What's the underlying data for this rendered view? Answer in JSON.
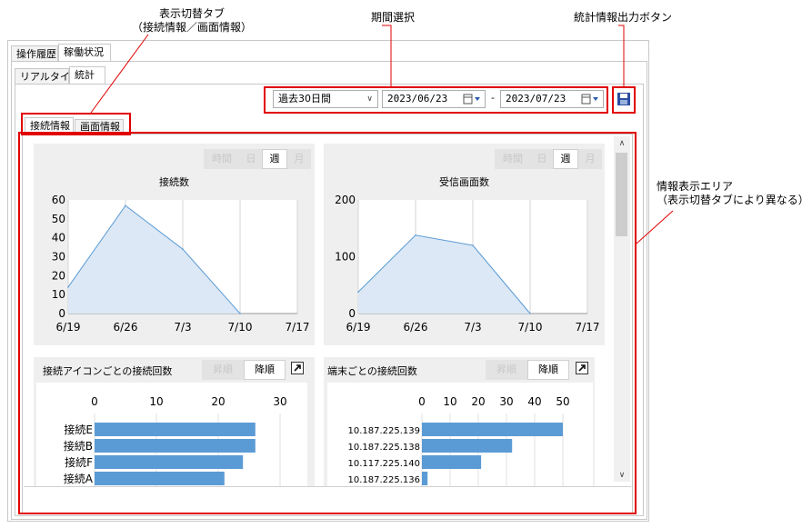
{
  "callouts": {
    "tab_switch_line1": "表示切替タブ",
    "tab_switch_line2": "（接続情報／画面情報）",
    "period_select": "期間選択",
    "stats_output": "統計情報出力ボタン",
    "info_area_line1": "情報表示エリア",
    "info_area_line2": "（表示切替タブにより異なる）"
  },
  "tabs_top": [
    "操作履歴",
    "稼働状況"
  ],
  "tabs_second": [
    "リアルタイム",
    "統計"
  ],
  "tabs_info": [
    "接続情報",
    "画面情報"
  ],
  "period": {
    "selected": "過去30日間",
    "from": "2023/06/23",
    "dash": "-",
    "to": "2023/07/23"
  },
  "segments_time": [
    "時間",
    "日",
    "週",
    "月"
  ],
  "segments_sort": [
    "昇順",
    "降順"
  ],
  "colors": {
    "accent": "#5b9bd5",
    "area": "#dce8f5",
    "highlight": "#e00000"
  },
  "icons": {
    "save": "floppy-disk-icon",
    "calendar": "calendar-icon",
    "popout": "popout-arrow-icon"
  },
  "chart_data": [
    {
      "type": "area",
      "title": "接続数",
      "categories": [
        "6/19",
        "6/26",
        "7/3",
        "7/10",
        "7/17"
      ],
      "x": [
        "6/19",
        "6/26",
        "7/3",
        "7/10"
      ],
      "values": [
        14,
        57,
        34,
        0
      ],
      "ylim": [
        0,
        60
      ],
      "yticks": [
        0,
        10,
        20,
        30,
        40,
        50,
        60
      ],
      "grid": true
    },
    {
      "type": "area",
      "title": "受信画面数",
      "categories": [
        "6/19",
        "6/26",
        "7/3",
        "7/10",
        "7/17"
      ],
      "x": [
        "6/19",
        "6/26",
        "7/3",
        "7/10"
      ],
      "values": [
        38,
        138,
        120,
        0
      ],
      "ylim": [
        0,
        200
      ],
      "yticks": [
        0,
        100,
        200
      ],
      "grid": true
    },
    {
      "type": "bar",
      "title": "接続アイコンごとの接続回数",
      "orientation": "horizontal",
      "categories": [
        "接続E",
        "接続B",
        "接続F",
        "接続A"
      ],
      "values": [
        26,
        26,
        24,
        21
      ],
      "xlim": [
        0,
        30
      ],
      "xticks": [
        0,
        10,
        20,
        30
      ]
    },
    {
      "type": "bar",
      "title": "端末ごとの接続回数",
      "orientation": "horizontal",
      "categories": [
        "10.187.225.139",
        "10.187.225.138",
        "10.117.225.140",
        "10.187.225.136"
      ],
      "values": [
        50,
        32,
        21,
        2
      ],
      "xlim": [
        0,
        50
      ],
      "xticks": [
        0,
        10,
        20,
        30,
        40,
        50
      ]
    }
  ]
}
